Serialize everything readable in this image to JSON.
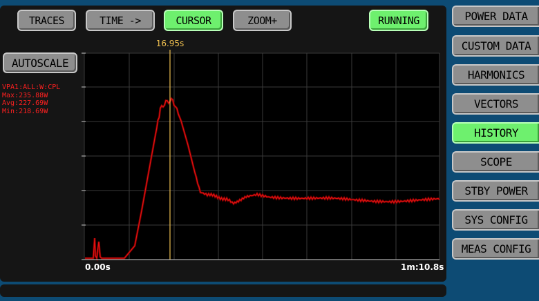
{
  "toolbar": {
    "traces": "TRACES",
    "time": "TIME ->",
    "cursor": "CURSOR",
    "zoom": "ZOOM+",
    "running": "RUNNING"
  },
  "autoscale": "AUTOSCALE",
  "measurement": {
    "channel": "VPA1:ALL:W:CPL",
    "max": "Max:235.88W",
    "avg": "Avg:227.69W",
    "min": "Min:218.69W"
  },
  "cursor_time": "16.95s",
  "axis": {
    "start": "0.00s",
    "end": "1m:10.8s"
  },
  "side_menu": [
    {
      "label": "POWER DATA",
      "active": false
    },
    {
      "label": "CUSTOM DATA",
      "active": false
    },
    {
      "label": "HARMONICS",
      "active": false
    },
    {
      "label": "VECTORS",
      "active": false
    },
    {
      "label": "HISTORY",
      "active": true
    },
    {
      "label": "SCOPE",
      "active": false
    },
    {
      "label": "STBY POWER",
      "active": false
    },
    {
      "label": "SYS CONFIG",
      "active": false
    },
    {
      "label": "MEAS CONFIG",
      "active": false
    }
  ],
  "colors": {
    "background": "#0d4b74",
    "panel": "#151515",
    "button": "#8e8e8e",
    "active_button": "#6ef06e",
    "trace": "#e01010",
    "cursor_line": "#f0c050",
    "stats_text": "#ff2020"
  }
}
